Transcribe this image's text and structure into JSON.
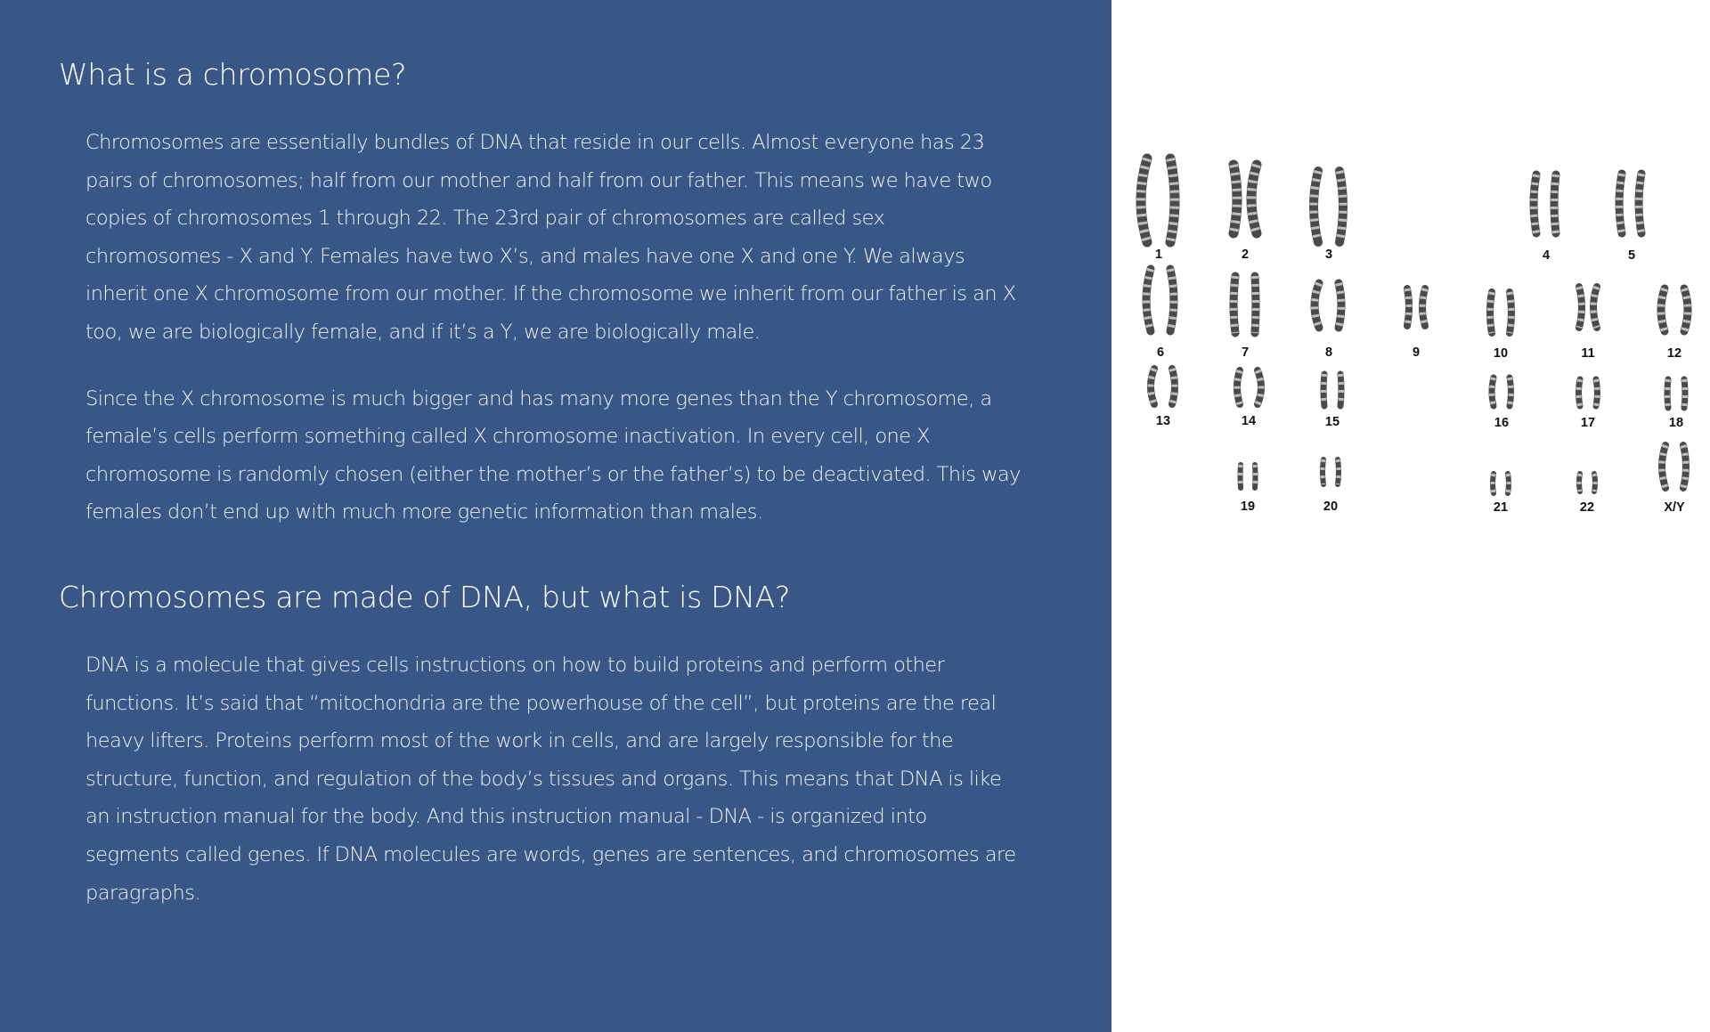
{
  "section1": {
    "title": "What is a chromosome?",
    "paragraphs": [
      "Chromosomes are essentially bundles of DNA that reside in our cells. Almost everyone has 23 pairs of chromosomes; half from our mother and half from our father. This means we have two copies of chromosomes 1 through 22. The 23rd pair of chromosomes are called sex chromosomes - X and Y. Females have two X’s, and males have one X and one Y. We always inherit one X chromosome from our mother. If the chromosome we inherit from our father is an X too, we are biologically female, and if it’s a Y, we are biologically male.",
      "Since the X chromosome is much bigger and has many more genes than the Y chromosome, a female’s cells perform something called X chromosome inactivation. In every cell, one X chromosome is randomly chosen (either the mother’s or the father’s) to be deactivated. This way females don’t end up with much more genetic information than males."
    ]
  },
  "section2": {
    "title": "Chromosomes are made of DNA, but what is DNA?",
    "paragraphs": [
      "DNA is a molecule that gives cells instructions on how to build proteins and perform other functions. It’s said that “mitochondria are the powerhouse of the cell”, but proteins are the real heavy lifters. Proteins perform most of the work in cells, and are largely responsible for the structure, function, and regulation of the body’s tissues and organs. This means that DNA is like an instruction manual for the body. And this instruction manual - DNA - is organized into segments called genes. If DNA molecules are words, genes are sentences, and chromosomes are paragraphs."
    ]
  },
  "karyotype": {
    "labels": [
      "1",
      "2",
      "3",
      "4",
      "5",
      "6",
      "7",
      "8",
      "9",
      "10",
      "11",
      "12",
      "13",
      "14",
      "15",
      "16",
      "17",
      "18",
      "19",
      "20",
      "21",
      "22",
      "X/Y"
    ]
  },
  "colors": {
    "panel_background": "#385786",
    "text": "#ffffff",
    "page_background": "#ffffff"
  }
}
